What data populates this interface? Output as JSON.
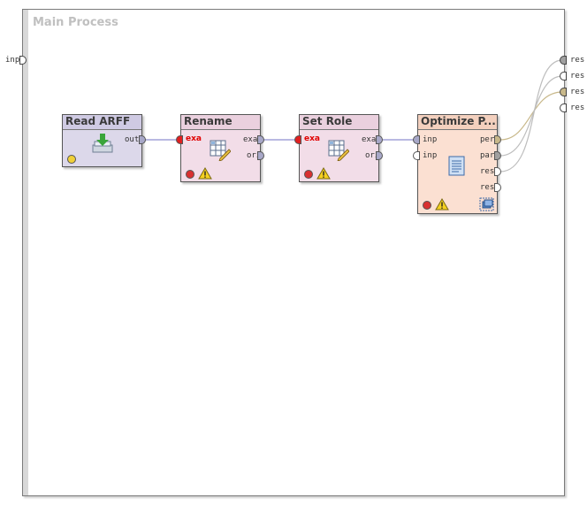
{
  "process": {
    "title": "Main Process"
  },
  "left_port": {
    "label": "inp"
  },
  "right_ports": [
    {
      "label": "res"
    },
    {
      "label": "res"
    },
    {
      "label": "res"
    },
    {
      "label": "res"
    }
  ],
  "operators": {
    "read_arff": {
      "title": "Read ARFF",
      "out": "out"
    },
    "rename": {
      "title": "Rename",
      "in": "exa",
      "out1": "exa",
      "out2": "ori"
    },
    "set_role": {
      "title": "Set Role",
      "in": "exa",
      "out1": "exa",
      "out2": "ori"
    },
    "optimize": {
      "title": "Optimize P...",
      "in1": "inp",
      "in2": "inp",
      "out1": "per",
      "out2": "par",
      "out3": "res",
      "out4": "res"
    }
  },
  "colors": {
    "reader_bg": "#dcd8ea",
    "transform_bg": "#f2dde8",
    "meta_bg": "#fbe0d2",
    "wire_example": "#8f8fd0",
    "wire_perf": "#c8b88a"
  },
  "icons": {
    "read_arff": "import-data-icon",
    "rename": "table-edit-icon",
    "set_role": "table-edit-icon",
    "optimize": "document-icon",
    "subprocess": "subprocess-icon",
    "status_warning": "warning-icon"
  }
}
